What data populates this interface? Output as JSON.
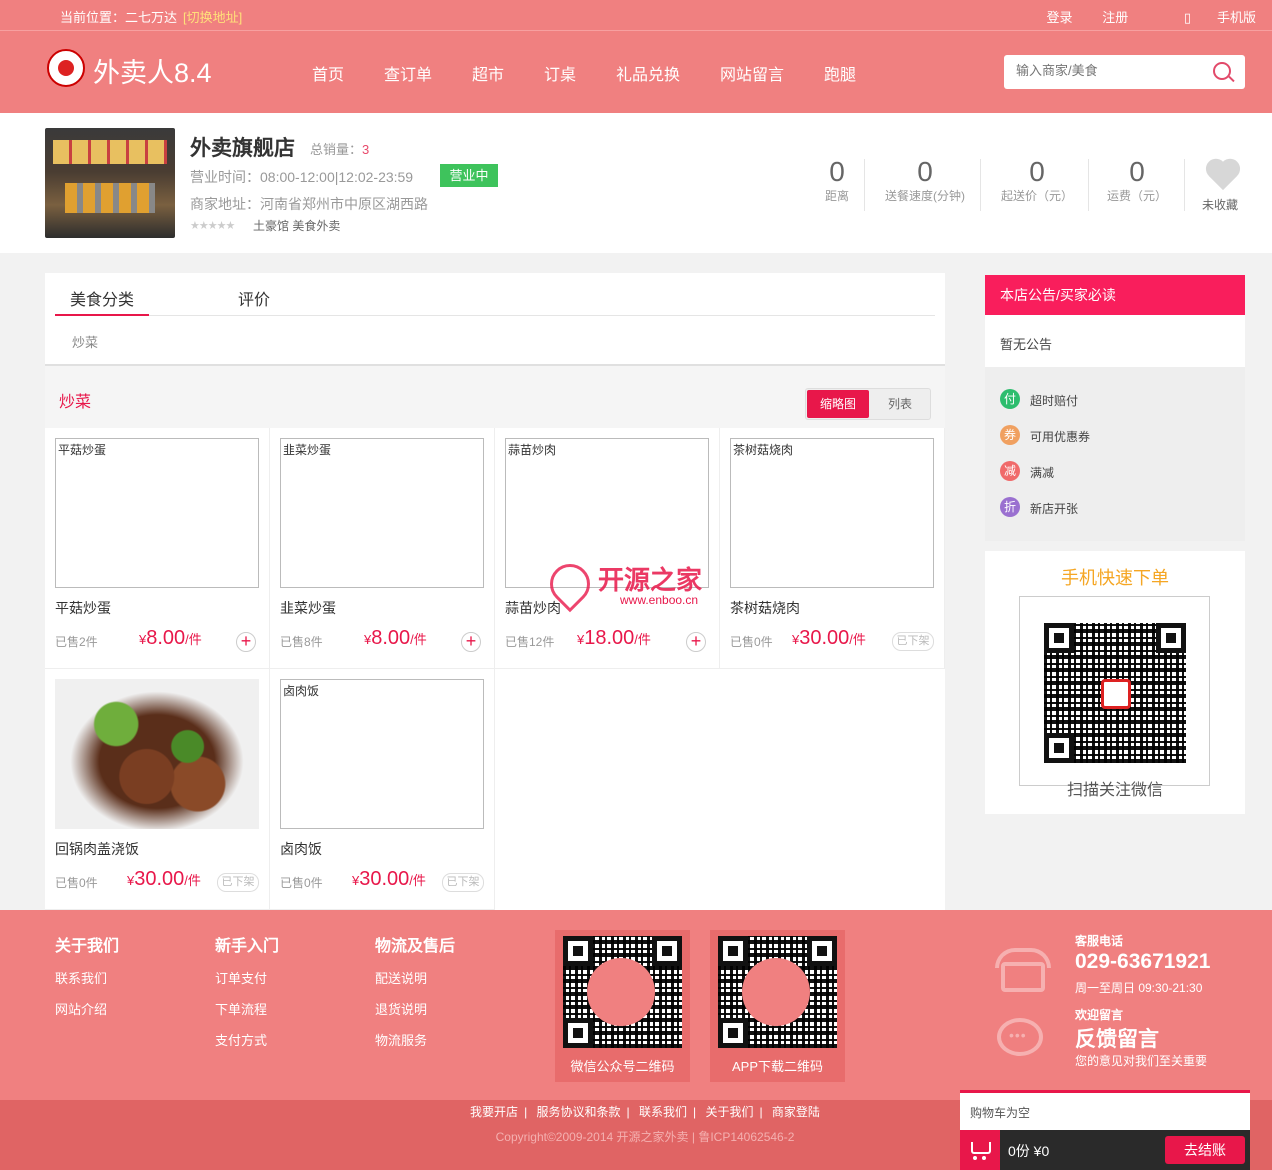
{
  "topbar": {
    "location_label": "当前位置：二七万达",
    "switch_label": "[切换地址]",
    "login": "登录",
    "register": "注册",
    "mobile": "手机版"
  },
  "header": {
    "logo_text": "外卖人8.4",
    "search_placeholder": "输入商家/美食",
    "nav": [
      "首页",
      "查订单",
      "超市",
      "订桌",
      "礼品兑换",
      "网站留言",
      "跑腿"
    ]
  },
  "shop": {
    "name": "外卖旗舰店",
    "sales_label": "总销量：",
    "sales_value": "3",
    "hours": "营业时间：08:00-12:00|12:02-23:59",
    "status": "营业中",
    "address": "商家地址：河南省郑州市中原区湖西路",
    "stars": "★★★★★",
    "tags": "土豪馆 美食外卖",
    "stats": [
      {
        "value": "0",
        "label": "距离"
      },
      {
        "value": "0",
        "label": "送餐速度(分钟)"
      },
      {
        "value": "0",
        "label": "起送价（元）"
      },
      {
        "value": "0",
        "label": "运费（元）"
      }
    ],
    "favorite_label": "未收藏"
  },
  "menu": {
    "tabs": [
      "美食分类",
      "评价"
    ],
    "category": "炒菜",
    "section_title": "炒菜",
    "view_thumb": "缩略图",
    "view_list": "列表",
    "items": [
      {
        "name": "平菇炒蛋",
        "alt": "平菇炒蛋",
        "sold": "已售2件",
        "currency": "¥",
        "price": "8.00",
        "unit": "/件",
        "state": "add"
      },
      {
        "name": "韭菜炒蛋",
        "alt": "韭菜炒蛋",
        "sold": "已售8件",
        "currency": "¥",
        "price": "8.00",
        "unit": "/件",
        "state": "add"
      },
      {
        "name": "蒜苗炒肉",
        "alt": "蒜苗炒肉",
        "sold": "已售12件",
        "currency": "¥",
        "price": "18.00",
        "unit": "/件",
        "state": "add"
      },
      {
        "name": "茶树菇烧肉",
        "alt": "茶树菇烧肉",
        "sold": "已售0件",
        "currency": "¥",
        "price": "30.00",
        "unit": "/件",
        "state": "已下架"
      },
      {
        "name": "回锅肉盖浇饭",
        "alt": "",
        "sold": "已售0件",
        "currency": "¥",
        "price": "30.00",
        "unit": "/件",
        "state": "已下架"
      },
      {
        "name": "卤肉饭",
        "alt": "卤肉饭",
        "sold": "已售0件",
        "currency": "¥",
        "price": "30.00",
        "unit": "/件",
        "state": "已下架"
      }
    ]
  },
  "watermark": {
    "title": "开源之家",
    "url": "www.enboo.cn"
  },
  "sidebar": {
    "notice_title": "本店公告/买家必读",
    "notice_text": "暂无公告",
    "features": [
      {
        "icon": "付",
        "label": "超时赔付",
        "color": "#2dbd6e"
      },
      {
        "icon": "券",
        "label": "可用优惠券",
        "color": "#f0a060"
      },
      {
        "icon": "减",
        "label": "满减",
        "color": "#f06a6a"
      },
      {
        "icon": "折",
        "label": "新店开张",
        "color": "#9a70d0"
      }
    ],
    "qr_title": "手机快速下单",
    "qr_caption": "扫描关注微信"
  },
  "footer": {
    "cols": [
      {
        "title": "关于我们",
        "links": [
          "联系我们",
          "网站介绍"
        ]
      },
      {
        "title": "新手入门",
        "links": [
          "订单支付",
          "下单流程",
          "支付方式"
        ]
      },
      {
        "title": "物流及售后",
        "links": [
          "配送说明",
          "退货说明",
          "物流服务"
        ]
      }
    ],
    "qr1_caption": "微信公众号二维码",
    "qr2_caption": "APP下载二维码",
    "phone_label": "客服电话",
    "phone": "029-63671921",
    "phone_hours": "周一至周日 09:30-21:30",
    "feedback_label": "欢迎留言",
    "feedback_title": "反馈留言",
    "feedback_desc": "您的意见对我们至关重要",
    "bottom_links": [
      "我要开店",
      "服务协议和条款",
      "联系我们",
      "关于我们",
      "商家登陆"
    ],
    "copyright": "Copyright©2009-2014 开源之家外卖 | 鲁ICP14062546-2"
  },
  "cart": {
    "empty": "购物车为空",
    "summary": "0份  ¥0",
    "checkout": "去结账"
  }
}
